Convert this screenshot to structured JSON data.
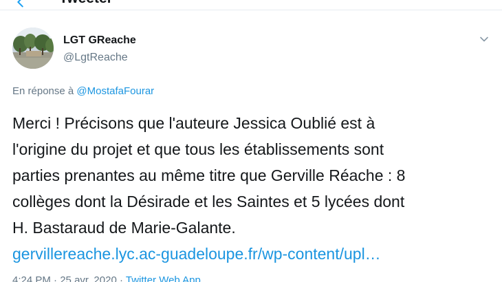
{
  "header": {
    "title": "Tweeter"
  },
  "tweet": {
    "author_name": "LGT GReache",
    "author_handle": "@LgtReache",
    "reply_prefix": "En réponse à ",
    "reply_mention": "@MostafaFourar",
    "text_lines": [
      "Merci ! Précisons que l'auteure Jessica Oublié est à",
      "l'origine du projet et que tous les établissements sont",
      "parties prenantes au même titre que Gerville Réache : 8",
      "collèges dont la Désirade et les Saintes et 5 lycées dont",
      "H. Bastaraud de Marie-Galante."
    ],
    "link": "gervillereache.lyc.ac-guadeloupe.fr/wp-content/upl…",
    "time": "4:24 PM",
    "date": "25 avr. 2020",
    "separator": " · ",
    "source": "Twitter Web App"
  },
  "colors": {
    "accent": "#1b95e0",
    "text": "#14171a",
    "muted": "#657786"
  },
  "icons": {
    "back": "back-arrow-icon",
    "caret": "chevron-down-icon"
  }
}
